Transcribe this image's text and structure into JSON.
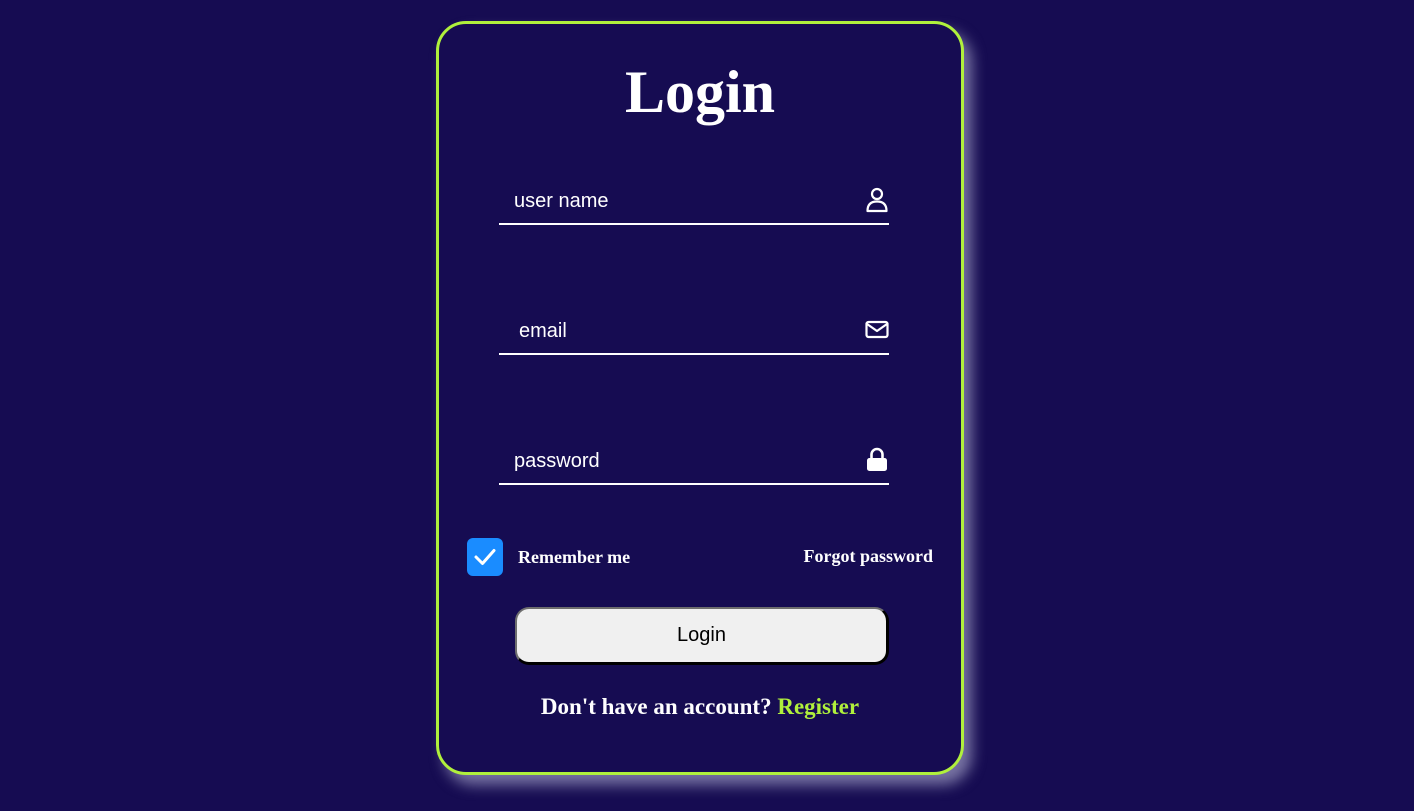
{
  "form": {
    "title": "Login",
    "fields": {
      "username": {
        "placeholder": "user name",
        "icon": "user-icon"
      },
      "email": {
        "placeholder": "email",
        "icon": "envelope-icon"
      },
      "password": {
        "placeholder": "password",
        "icon": "lock-icon"
      }
    },
    "remember": {
      "label": "Remember me",
      "checked": true
    },
    "forgot_label": "Forgot password",
    "submit_label": "Login",
    "register_prompt": "Don't have an account?",
    "register_link": "Register"
  },
  "colors": {
    "background": "#160c52",
    "accent": "#b0f03c",
    "checkbox": "#1a8cff",
    "button_bg": "#f0f0f0"
  }
}
